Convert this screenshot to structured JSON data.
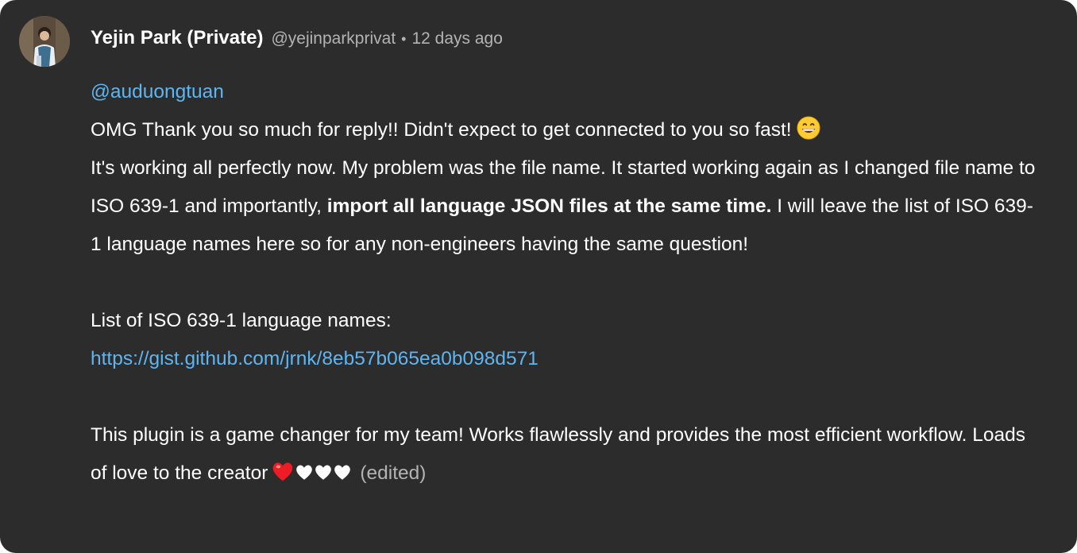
{
  "comment": {
    "author_name": "Yejin Park (Private)",
    "author_handle": "@yejinparkprivat",
    "separator": "•",
    "time_ago": "12 days ago",
    "mention": "@auduongtuan",
    "para1_line1": "OMG Thank you so much for reply!! Didn't expect to get connected to you so fast!",
    "para1_text_a": "It's working all perfectly now. My problem was the file name. It started working again as I changed file name to ISO 639-1 and importantly,",
    "para1_bold": "import all language JSON files at the same time.",
    "para1_text_b": "I will leave the list of ISO 639-1 language names here so for any non-engineers having the same question!",
    "list_label": "List of ISO 639-1 language names:",
    "link_url": "https://gist.github.com/jrnk/8eb57b065ea0b098d571",
    "para3_text": "This plugin is a game changer for my team! Works flawlessly and provides the most efficient workflow. Loads of love to the creator",
    "edited_label": "(edited)",
    "emojis": [
      "grinning-face",
      "red-heart",
      "white-heart",
      "white-heart",
      "white-heart"
    ]
  },
  "colors": {
    "card_background": "#2c2c2c",
    "link": "#5db6f2",
    "muted_text": "#b3b3b3",
    "text": "#ffffff"
  }
}
